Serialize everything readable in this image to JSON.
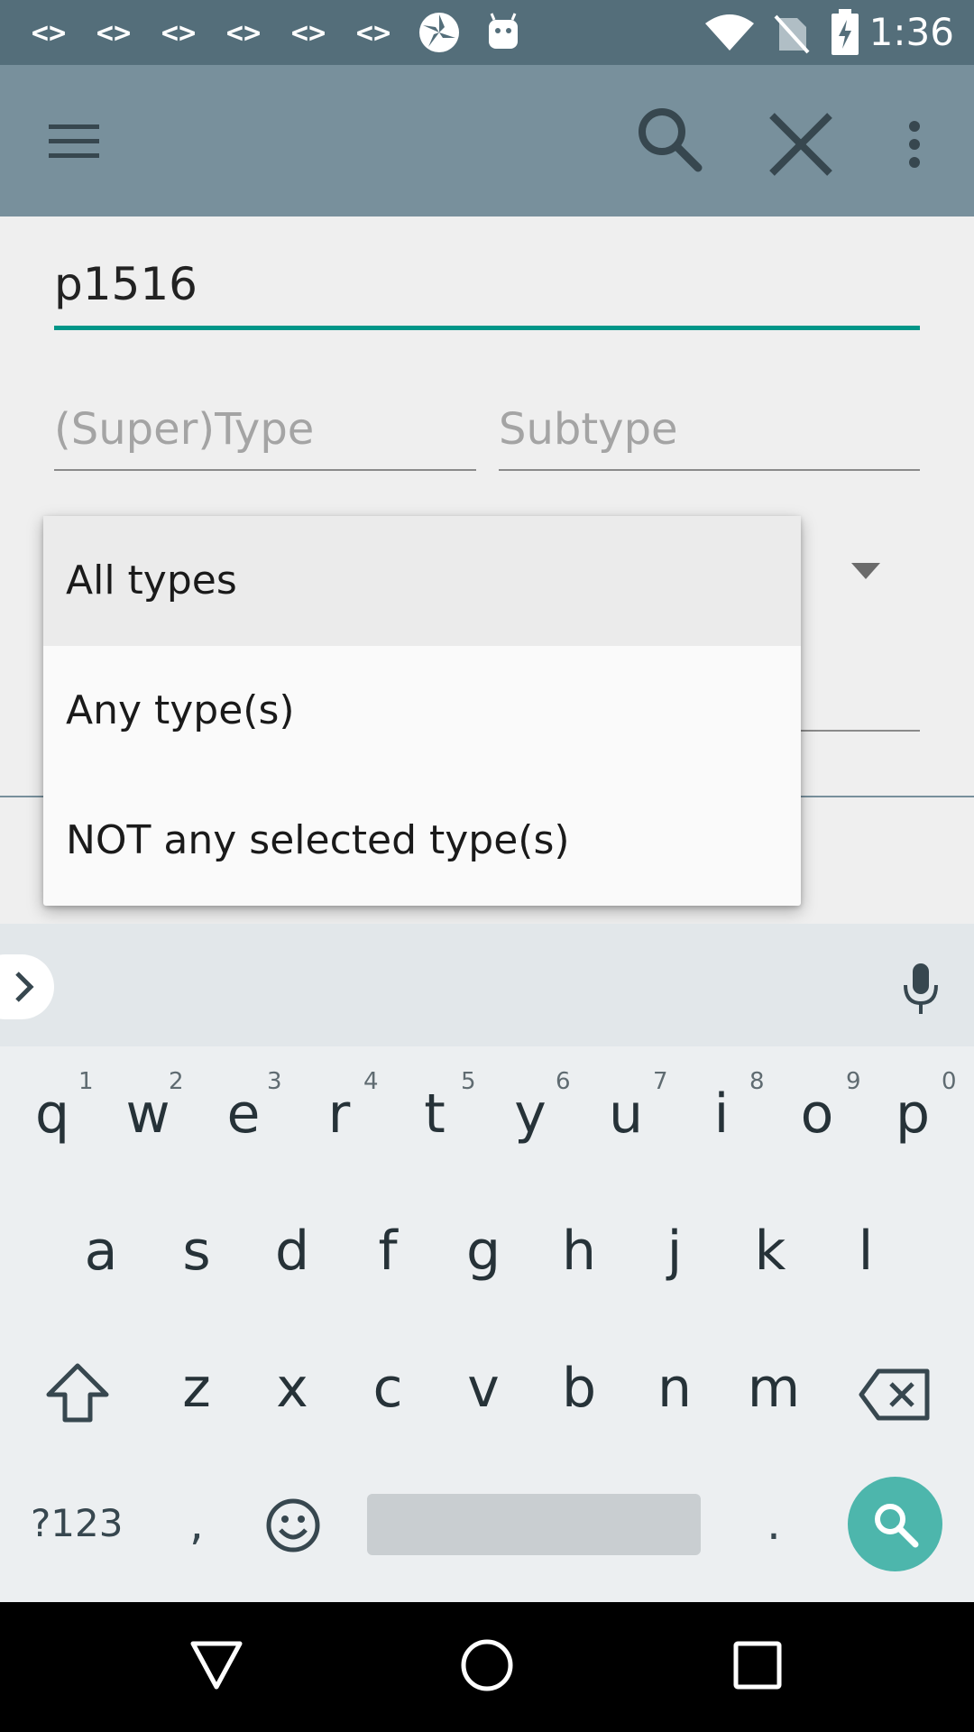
{
  "status_bar": {
    "time": "1:36",
    "notification_icons": [
      "code-icon",
      "code-icon",
      "code-icon",
      "code-icon",
      "code-icon",
      "code-icon",
      "pinwheel-icon",
      "android-icon"
    ],
    "code_glyph": "<>",
    "right_icons": [
      "wifi-icon",
      "no-sim-icon",
      "battery-charging-icon"
    ]
  },
  "app_bar": {
    "background": "#78909c",
    "icons": [
      "menu-icon",
      "search-icon",
      "close-icon",
      "more-vert-icon"
    ]
  },
  "form": {
    "name_value": "p1516",
    "supertype_placeholder": "(Super)Type",
    "subtype_placeholder": "Subtype",
    "accent": "#009688"
  },
  "dropdown": {
    "options": [
      "All types",
      "Any type(s)",
      "NOT any selected type(s)"
    ],
    "selected_index": 0
  },
  "keyboard": {
    "row1": [
      "q",
      "w",
      "e",
      "r",
      "t",
      "y",
      "u",
      "i",
      "o",
      "p"
    ],
    "row1_hints": [
      "1",
      "2",
      "3",
      "4",
      "5",
      "6",
      "7",
      "8",
      "9",
      "0"
    ],
    "row2": [
      "a",
      "s",
      "d",
      "f",
      "g",
      "h",
      "j",
      "k",
      "l"
    ],
    "row3": [
      "z",
      "x",
      "c",
      "v",
      "b",
      "n",
      "m"
    ],
    "symbols_key": "?123",
    "comma_key": ",",
    "period_key": ".",
    "action_color": "#4db6ac"
  },
  "nav_bar": {
    "icons": [
      "back-icon",
      "home-icon",
      "recents-icon"
    ]
  }
}
